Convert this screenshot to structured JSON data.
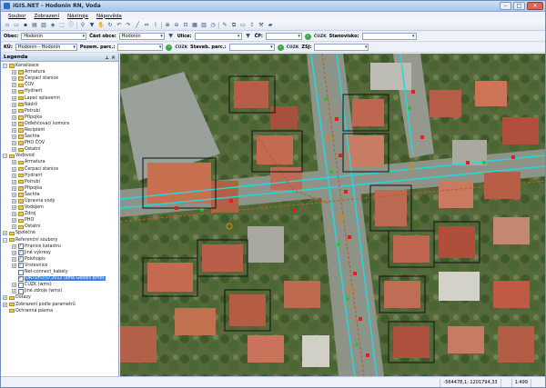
{
  "window": {
    "title": "iGIS.NET - Hodonín RN, Voda",
    "btn_min": "–",
    "btn_max": "□",
    "btn_close": "✕"
  },
  "menu": [
    "Soubor",
    "Zobrazení",
    "Nástroje",
    "Nápověda"
  ],
  "row1": {
    "obec_label": "Obec:",
    "obec_value": "Hodonín",
    "cast_label": "Část obce:",
    "cast_value": "Hodonín",
    "ulice_label": "Ulice:",
    "ulice_value": "",
    "cp_label": "ČP:",
    "cuzk1": "ČÚZK",
    "stanovisko_label": "Stanovisko:",
    "stanovisko_value": ""
  },
  "row2": {
    "ku_label": "KÚ:",
    "ku_value": "Hodonín - Hodonín",
    "pozem_label": "Pozem. parc.:",
    "pozem_value": "",
    "cuzk2": "ČÚZK",
    "staveb_label": "Staveb. parc.:",
    "staveb_value": "",
    "cuzk3": "ČÚZK",
    "zsj_label": "ZSJ:",
    "zsj_value": ""
  },
  "legend": {
    "title": "Legenda",
    "items": [
      {
        "label": "Kanalizace",
        "level": 1,
        "exp": "−",
        "type": "folder"
      },
      {
        "label": "Armatura",
        "level": 2,
        "exp": "+",
        "type": "folder"
      },
      {
        "label": "Čerpací stanice",
        "level": 2,
        "exp": "+",
        "type": "folder"
      },
      {
        "label": "ČOV",
        "level": 2,
        "exp": "+",
        "type": "folder"
      },
      {
        "label": "Hydrant",
        "level": 2,
        "exp": "+",
        "type": "folder"
      },
      {
        "label": "Lapač splavenin",
        "level": 2,
        "exp": "+",
        "type": "folder"
      },
      {
        "label": "Nádrž",
        "level": 2,
        "exp": "+",
        "type": "folder"
      },
      {
        "label": "Potrubí",
        "level": 2,
        "exp": "+",
        "type": "folder"
      },
      {
        "label": "Přípojka",
        "level": 2,
        "exp": "+",
        "type": "folder"
      },
      {
        "label": "Odlehčovací komora",
        "level": 2,
        "exp": "+",
        "type": "folder"
      },
      {
        "label": "Recipient",
        "level": 2,
        "exp": "+",
        "type": "folder"
      },
      {
        "label": "Šachta",
        "level": 2,
        "exp": "+",
        "type": "folder"
      },
      {
        "label": "PHO ČOV",
        "level": 2,
        "exp": "+",
        "type": "folder"
      },
      {
        "label": "Ostatní",
        "level": 2,
        "exp": "+",
        "type": "folder"
      },
      {
        "label": "Vodovod",
        "level": 1,
        "exp": "−",
        "type": "folder"
      },
      {
        "label": "Armatura",
        "level": 2,
        "exp": "+",
        "type": "folder"
      },
      {
        "label": "Čerpací stanice",
        "level": 2,
        "exp": "+",
        "type": "folder"
      },
      {
        "label": "Hydrant",
        "level": 2,
        "exp": "+",
        "type": "folder"
      },
      {
        "label": "Potrubí",
        "level": 2,
        "exp": "+",
        "type": "folder"
      },
      {
        "label": "Přípojka",
        "level": 2,
        "exp": "+",
        "type": "folder"
      },
      {
        "label": "Šachta",
        "level": 2,
        "exp": "+",
        "type": "folder"
      },
      {
        "label": "Úpravna vody",
        "level": 2,
        "exp": "+",
        "type": "folder"
      },
      {
        "label": "Vodojem",
        "level": 2,
        "exp": "+",
        "type": "folder"
      },
      {
        "label": "Zdroj",
        "level": 2,
        "exp": "+",
        "type": "folder"
      },
      {
        "label": "PHO",
        "level": 2,
        "exp": "+",
        "type": "folder"
      },
      {
        "label": "Ostatní",
        "level": 2,
        "exp": "+",
        "type": "folder"
      },
      {
        "label": "Společné",
        "level": 1,
        "exp": "+",
        "type": "folder"
      },
      {
        "label": "Referenční soubory",
        "level": 1,
        "exp": "−",
        "type": "folder"
      },
      {
        "label": "Hranice katastru",
        "level": 2,
        "exp": "+",
        "type": "check",
        "checked": true
      },
      {
        "label": "Jiné výkresy",
        "level": 2,
        "exp": "+",
        "type": "check",
        "checked": true
      },
      {
        "label": "Polohopis",
        "level": 2,
        "exp": "+",
        "type": "check",
        "checked": true
      },
      {
        "label": "Vrstevnice",
        "level": 2,
        "exp": "+",
        "type": "check",
        "checked": true
      },
      {
        "label": "Net-connect_kabely",
        "level": 2,
        "exp": "",
        "type": "check",
        "checked": false
      },
      {
        "label": "ORTOFOTO 2012 (sma Geodis Brno)",
        "level": 2,
        "exp": "",
        "type": "check",
        "checked": true,
        "selected": true
      },
      {
        "label": "ČÚZK (wms)",
        "level": 2,
        "exp": "+",
        "type": "check",
        "checked": false
      },
      {
        "label": "Jiné zdroje (wms)",
        "level": 2,
        "exp": "+",
        "type": "check",
        "checked": false
      },
      {
        "label": "Dotazy",
        "level": 1,
        "exp": "+",
        "type": "folder"
      },
      {
        "label": "Zobrazení podle parametrů",
        "level": 1,
        "exp": "+",
        "type": "folder"
      },
      {
        "label": "Ochranná pásma",
        "level": 1,
        "exp": "",
        "type": "folder"
      }
    ]
  },
  "status": {
    "coords": "-564478,1; 1201794,33",
    "scale": "1:499"
  },
  "icons": {
    "check_mark": "✓",
    "pin": "📌"
  }
}
